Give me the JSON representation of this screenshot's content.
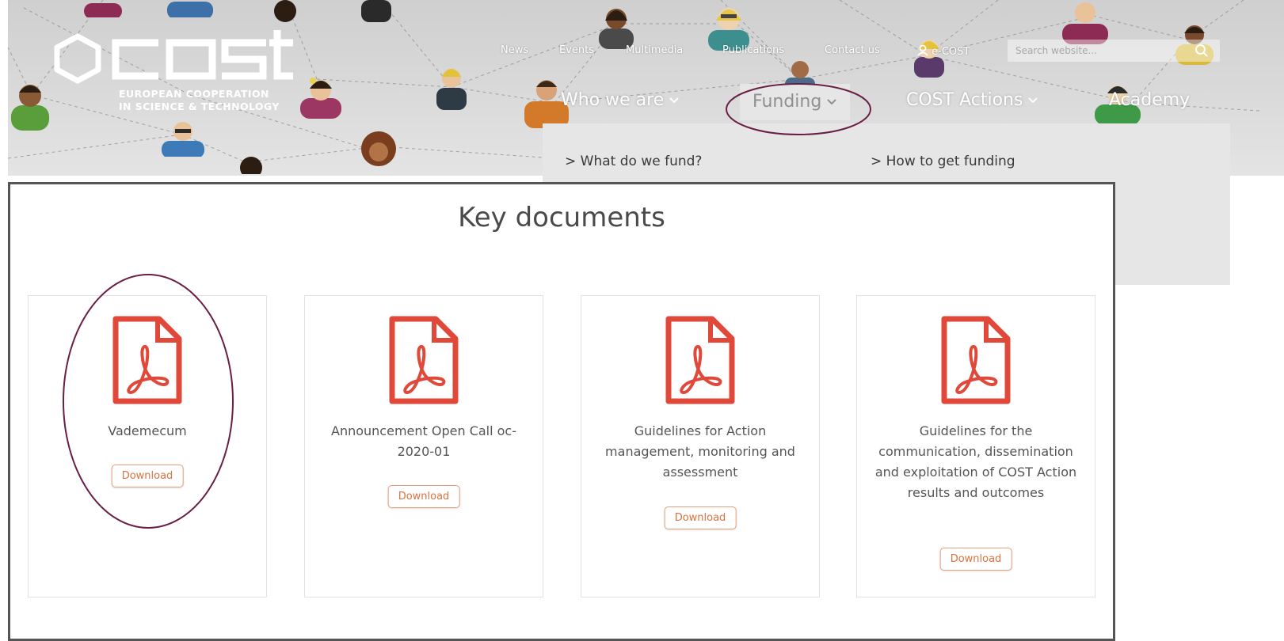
{
  "header": {
    "logo_wordmark": "cost",
    "logo_tagline_1": "EUROPEAN COOPERATION",
    "logo_tagline_2": "IN SCIENCE & TECHNOLOGY",
    "top_links": [
      "News",
      "Events",
      "Multimedia",
      "Publications",
      "Contact us"
    ],
    "ecost_label": "e-COST",
    "search_placeholder": "Search website...",
    "main_nav": [
      {
        "label": "Who we are",
        "has_dropdown": true
      },
      {
        "label": "Funding",
        "has_dropdown": true,
        "active": true
      },
      {
        "label": "COST Actions",
        "has_dropdown": true
      },
      {
        "label": "Academy",
        "has_dropdown": false
      }
    ]
  },
  "dropdown": {
    "items": [
      "> What do we fund?",
      "> How to get funding"
    ]
  },
  "key_documents": {
    "title": "Key documents",
    "cards": [
      {
        "title": "Vademecum",
        "button": "Download",
        "icon": "pdf-icon"
      },
      {
        "title": "Announcement Open Call oc-2020-01",
        "button": "Download",
        "icon": "pdf-icon"
      },
      {
        "title": "Guidelines for Action management, monitoring and assessment",
        "button": "Download",
        "icon": "pdf-icon"
      },
      {
        "title": "Guidelines for the communication, dissemination and exploitation of COST Action results and outcomes",
        "button": "Download",
        "icon": "pdf-icon"
      }
    ]
  },
  "colors": {
    "pdf_red": "#e0493a",
    "download_orange": "#d9733f",
    "annotation_oval": "#6b1e45",
    "dropdown_bg": "#e6e6e6"
  }
}
